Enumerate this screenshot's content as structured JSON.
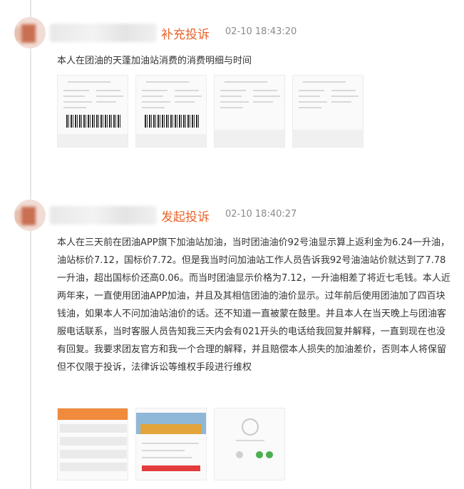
{
  "entries": [
    {
      "action": "补充投诉",
      "time": "02-10 18:43:20",
      "text": "本人在团油的天蓬加油站消费的消费明细与时间",
      "images": [
        "receipt-image",
        "receipt-image",
        "receipt-image",
        "receipt-image"
      ]
    },
    {
      "action": "发起投诉",
      "time": "02-10 18:40:27",
      "text": "本人在三天前在团油APP旗下加油站加油，当时团油油价92号油显示算上返利金为6.24一升油，油站标价7.12，国标价7.72。但是我当时问加油站工作人员告诉我92号油油站价就达到了7.78一升油，超出国标价还高0.06。而当时团油显示价格为7.12，一升油相差了将近七毛钱。本人近两年来，一直使用团油APP加油，并且及其相信团油的油价显示。过年前后使用团油加了四百块钱油，如果本人不问加油站油价的话。还不知道一直被蒙在鼓里。并且本人在当天晚上与团油客服电话联系，当时客服人员告知我三天内会有021开头的电话给我回复并解释，一直到现在也没有回复。我要求团友官方和我一个合理的解释，并且赔偿本人损失的加油差价，否则本人将保留但不仅限于投诉，法律诉讼等维权手段进行维权",
      "images": [
        "app-screenshot",
        "station-photo",
        "call-screenshot"
      ]
    }
  ]
}
